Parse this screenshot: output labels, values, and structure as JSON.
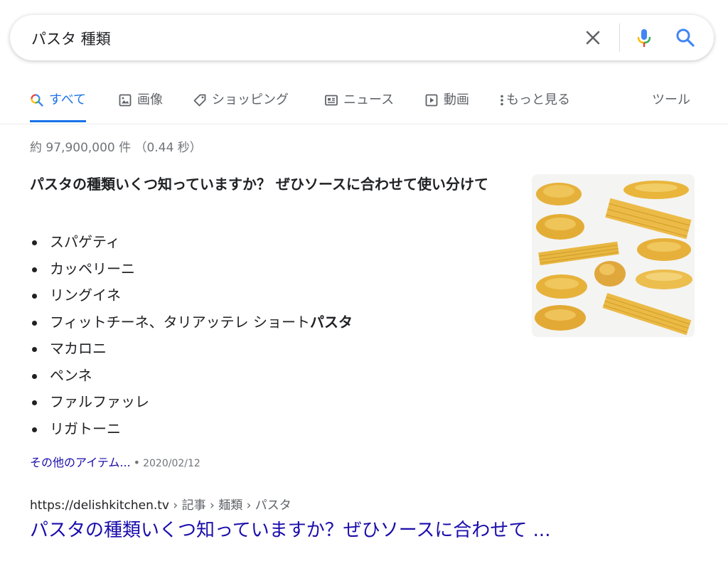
{
  "search": {
    "query": "パスタ 種類"
  },
  "tabs": [
    {
      "label": "すべて",
      "icon": "search-icon",
      "active": true
    },
    {
      "label": "画像",
      "icon": "image-icon"
    },
    {
      "label": "ショッピング",
      "icon": "tag-icon"
    },
    {
      "label": "ニュース",
      "icon": "newspaper-icon"
    },
    {
      "label": "動画",
      "icon": "video-icon"
    },
    {
      "label": "もっと見る",
      "icon": "more-vert-icon"
    }
  ],
  "tools_label": "ツール",
  "result_stats": "約 97,900,000 件 （0.44 秒）",
  "featured_snippet": {
    "title": "パスタの種類いくつ知っていますか？ ぜひソースに合わせて使い分けて",
    "items": [
      {
        "text": "スパゲティ"
      },
      {
        "text": "カッペリーニ"
      },
      {
        "text": "リングイネ"
      },
      {
        "text": "フィットチーネ、タリアッテレ ショート",
        "bold": "パスタ"
      },
      {
        "text": "マカロニ"
      },
      {
        "text": "ペンネ"
      },
      {
        "text": "ファルファッレ"
      },
      {
        "text": "リガトーニ"
      }
    ],
    "more_link": "その他のアイテム...",
    "separator": "•",
    "date": "2020/02/12"
  },
  "result": {
    "url": "https://delishkitchen.tv",
    "breadcrumb": " › 記事 › 麺類 › パスタ",
    "title": "パスタの種類いくつ知っていますか？ぜひソースに合わせて ..."
  },
  "colors": {
    "link": "#1a0dab",
    "accent": "#1a73e8",
    "muted": "#70757a",
    "pasta": "#e8b23a"
  }
}
